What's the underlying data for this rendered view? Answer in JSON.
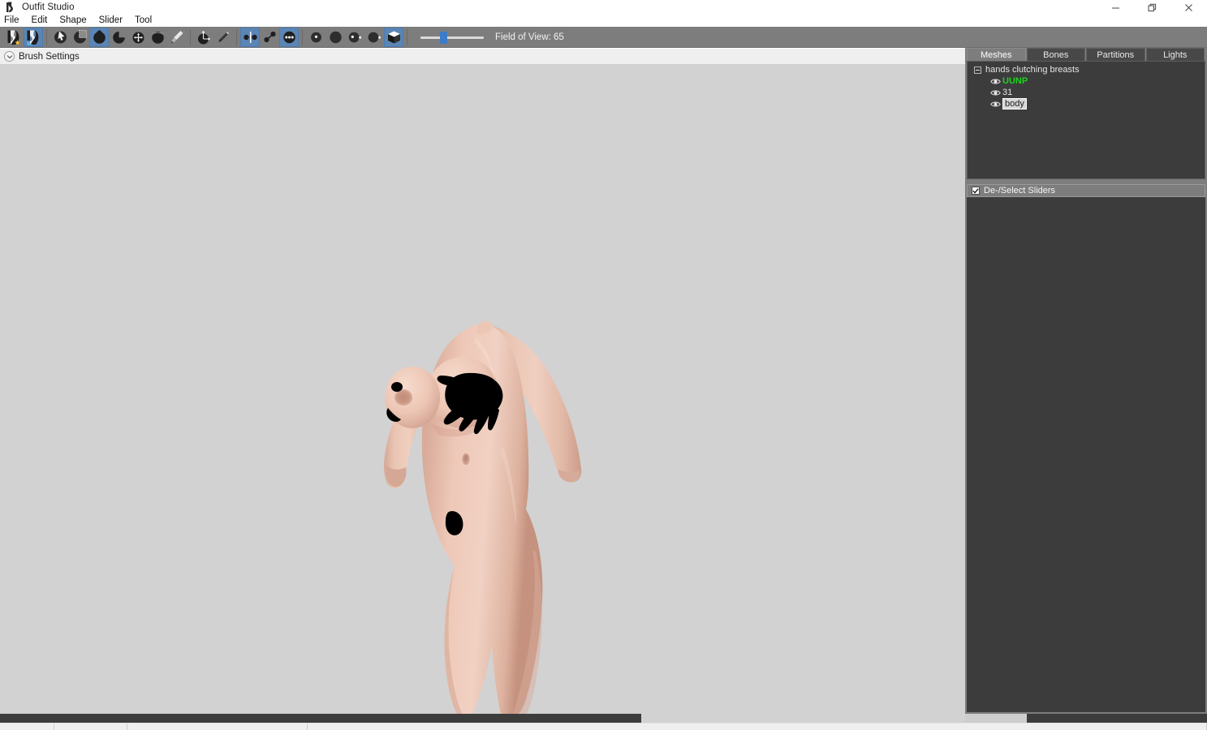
{
  "window": {
    "title": "Outfit Studio",
    "app_icon": "outfit-studio-icon",
    "controls": {
      "minimize": "minimize-icon",
      "restore": "restore-icon",
      "close": "close-icon"
    }
  },
  "menubar": {
    "items": [
      {
        "label": "File"
      },
      {
        "label": "Edit"
      },
      {
        "label": "Shape"
      },
      {
        "label": "Slider"
      },
      {
        "label": "Tool"
      }
    ]
  },
  "toolbar": {
    "groups": [
      {
        "name": "file-group",
        "buttons": [
          {
            "icon": "new-project-icon",
            "active": false
          },
          {
            "icon": "load-project-icon",
            "active": false
          }
        ]
      },
      {
        "name": "brush-group",
        "buttons": [
          {
            "icon": "select-brush-icon",
            "active": false
          },
          {
            "icon": "mask-brush-icon",
            "active": false
          },
          {
            "icon": "inflate-brush-icon",
            "active": true
          },
          {
            "icon": "deflate-brush-icon",
            "active": false
          },
          {
            "icon": "move-brush-icon",
            "active": false
          },
          {
            "icon": "smooth-brush-icon",
            "active": false
          },
          {
            "icon": "weight-paint-brush-icon",
            "active": false
          }
        ]
      },
      {
        "name": "transform-group",
        "buttons": [
          {
            "icon": "transform-axis-icon",
            "active": false
          },
          {
            "icon": "pencil-vertex-edit-icon",
            "active": false
          }
        ]
      },
      {
        "name": "view-group",
        "buttons": [
          {
            "icon": "xmirror-icon",
            "active": true
          },
          {
            "icon": "connected-only-icon",
            "active": false
          },
          {
            "icon": "show-vertices-icon",
            "active": true
          }
        ]
      },
      {
        "name": "lighting-group",
        "buttons": [
          {
            "icon": "light-frontal-icon",
            "active": false
          },
          {
            "icon": "light-ambient-icon",
            "active": false
          },
          {
            "icon": "light-directional-icon",
            "active": false
          },
          {
            "icon": "light-back-icon",
            "active": false
          },
          {
            "icon": "texture-cube-icon",
            "active": true
          }
        ]
      }
    ],
    "field_of_view": {
      "label": "Field of View: 65",
      "value": 65,
      "min": 40,
      "max": 140,
      "thumb_percent": 31
    }
  },
  "brush_settings": {
    "label": "Brush Settings",
    "chevron_icon": "chevron-down-icon",
    "expanded": false
  },
  "viewport": {
    "background_color": "#d2d2d2",
    "content_description": "3D character body mesh preview",
    "mesh_overlay_color": "#000000",
    "skin_color": "#e8c3b4"
  },
  "right_panel": {
    "tabs": [
      {
        "label": "Meshes",
        "active": true
      },
      {
        "label": "Bones",
        "active": false
      },
      {
        "label": "Partitions",
        "active": false
      },
      {
        "label": "Lights",
        "active": false
      }
    ],
    "mesh_tree": [
      {
        "label": "hands clutching breasts",
        "level": 0,
        "expander": "collapse-box-icon",
        "expanded": true,
        "state": "normal",
        "has_eye": false
      },
      {
        "label": "UUNP",
        "level": 1,
        "state": "green",
        "has_eye": true,
        "eye_icon": "eye-visible-icon"
      },
      {
        "label": "31",
        "level": 1,
        "state": "normal",
        "has_eye": true,
        "eye_icon": "eye-visible-icon"
      },
      {
        "label": "body",
        "level": 1,
        "state": "selected",
        "has_eye": true,
        "eye_icon": "eye-visible-icon"
      }
    ],
    "sliders_section": {
      "label": "De-/Select Sliders",
      "checked": true,
      "checkbox_icon": "checkbox-checked-icon",
      "items": []
    }
  },
  "scrollbar": {
    "horizontal": {
      "thumb_percent": 66,
      "name": "viewport-horizontal-scrollbar"
    }
  },
  "statusbar": {
    "cells": [
      "",
      "",
      "",
      "",
      ""
    ]
  },
  "colors": {
    "accent": "#3d7cc9",
    "toolbar_bg": "#7d7d7d",
    "panel_bg": "#3c3c3c",
    "viewport_bg": "#d2d2d2",
    "active_tool": "#5b85b5",
    "tree_highlight": "#1fd21f"
  }
}
